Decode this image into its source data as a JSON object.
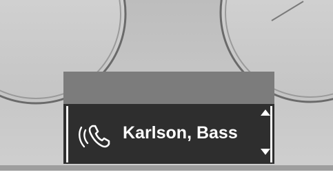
{
  "display": {
    "contact_name": "Karlson, Bass",
    "icon": "phone-handset-icon",
    "scroll_up_icon": "arrow-up-icon",
    "scroll_down_icon": "arrow-down-icon"
  },
  "colors": {
    "panel_bg": "#c8c8c8",
    "display_header": "#7c7c7c",
    "display_body": "#2e2e2e",
    "text": "#ffffff"
  }
}
